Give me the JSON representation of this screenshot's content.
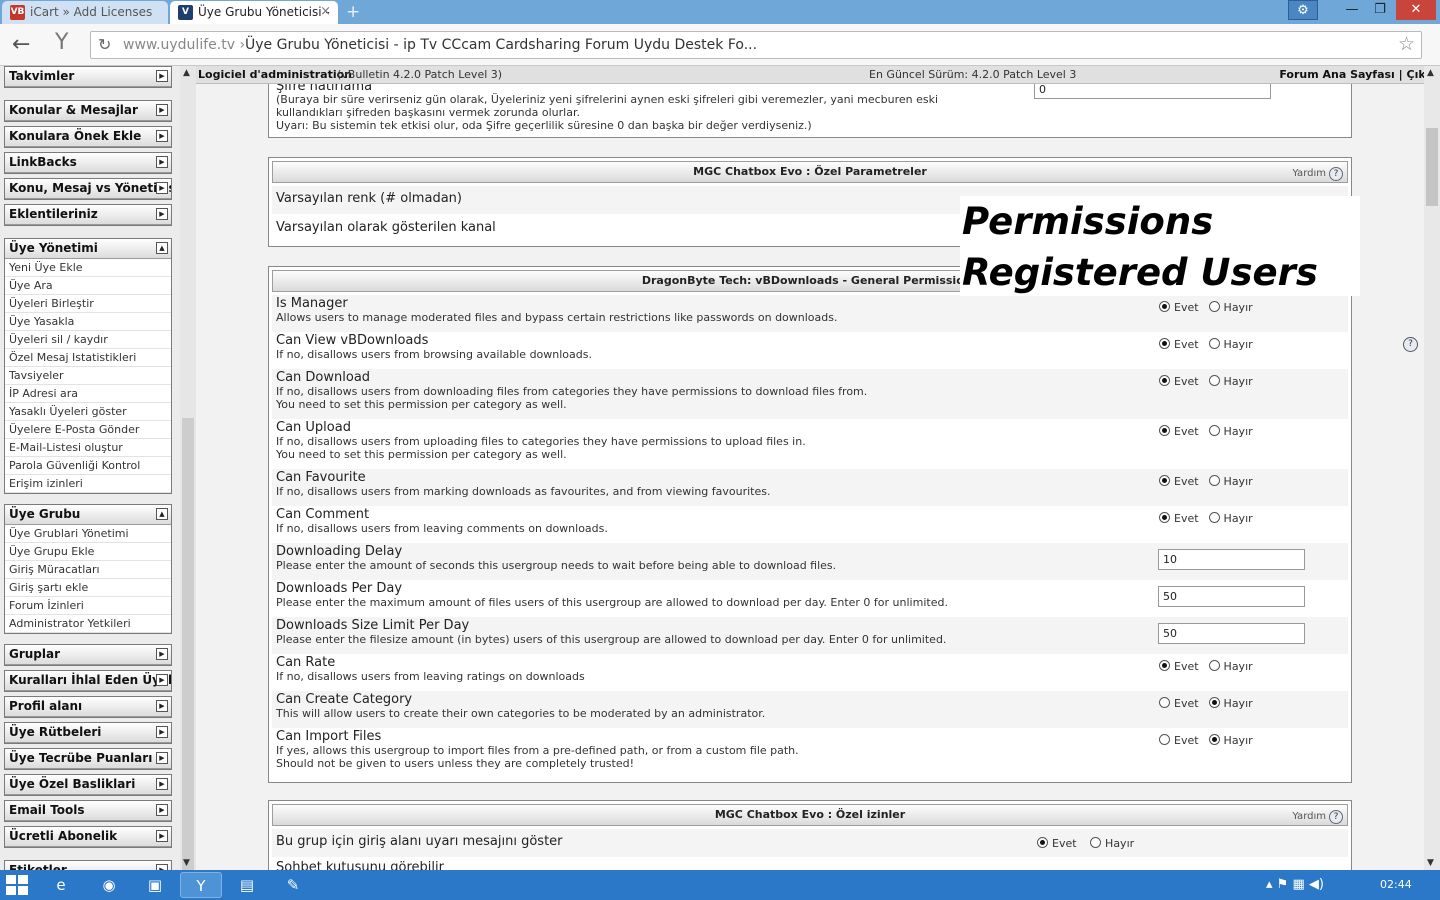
{
  "browser": {
    "tabs": [
      {
        "label": "iCart » Add Licenses",
        "favicon": "VB"
      },
      {
        "label": "Üye Grubu Yöneticisi -",
        "favicon": "V"
      }
    ],
    "new_tab": "+",
    "url_domain": "www.uydulife.tv",
    "url_sep": "›",
    "page_title": "Üye Grubu Yöneticisi - ip Tv CCcam Cardsharing Forum Uydu Destek Fo..."
  },
  "admin_bar": {
    "title": "Logiciel d'administration",
    "version": "(vBulletin 4.2.0 Patch Level 3)",
    "latest": "En Güncel Sürüm: 4.2.0 Patch Level 3",
    "links": "Forum Ana Sayfası | Çıkış"
  },
  "sidebar": {
    "groups": [
      {
        "title": "Takvimler",
        "items": []
      },
      {
        "title": "Konular & Mesajlar",
        "items": []
      },
      {
        "title": "Konulara Önek Ekle",
        "items": []
      },
      {
        "title": "LinkBacks",
        "items": []
      },
      {
        "title": "Konu, Mesaj vs Yöneticisi",
        "items": []
      },
      {
        "title": "Eklentileriniz",
        "items": []
      },
      {
        "title": "Üye Yönetimi",
        "items": [
          "Yeni Üye Ekle",
          "Üye Ara",
          "Üyeleri Birleştir",
          "Üye Yasakla",
          "Üyeleri sil / kaydır",
          "Özel Mesaj Istatistikleri",
          "Tavsiyeler",
          "İP Adresi ara",
          "Yasaklı Üyeleri göster",
          "Üyelere E-Posta Gönder",
          "E-Mail-Listesi oluştur",
          "Parola Güvenliği Kontrol",
          "Erişim izinleri"
        ]
      },
      {
        "title": "Üye Grubu",
        "items": [
          "Üye Grublari Yönetimi",
          "Üye Grupu Ekle",
          "Giriş Müracatları",
          "Giriş şartı ekle",
          "Forum İzinleri",
          "Administrator Yetkileri"
        ]
      },
      {
        "title": "Gruplar",
        "items": []
      },
      {
        "title": "Kuralları İhlal Eden Üyeler",
        "items": []
      },
      {
        "title": "Profil alanı",
        "items": []
      },
      {
        "title": "Üye Rütbeleri",
        "items": []
      },
      {
        "title": "Üye Tecrübe Puanları",
        "items": []
      },
      {
        "title": "Üye Özel Basliklari",
        "items": []
      },
      {
        "title": "Email Tools",
        "items": []
      },
      {
        "title": "Ücretli Abonelik",
        "items": []
      },
      {
        "title": "Etiketler",
        "items": []
      }
    ]
  },
  "top_section": {
    "title": "Şifre hatırlama",
    "desc": [
      "(Buraya bir süre verirseniz gün olarak, Üyeleriniz yeni şifrelerini aynen eski şifreleri gibi veremezler, yani mecburen eski",
      "kullandıkları şifreden başkasını vermek zorunda olurlar.",
      "Uyarı: Bu sistemin tek etkisi olur, oda Şifre geçerlilik süresine 0 dan başka bir değer verdiyseniz.)"
    ],
    "value": "0"
  },
  "chatbox_params": {
    "header": "MGC Chatbox Evo : Özel Parametreler",
    "help": "Yardım",
    "rows": [
      "Varsayılan renk (# olmadan)",
      "Varsayılan olarak gösterilen kanal"
    ]
  },
  "downloads": {
    "header": "DragonByte Tech: vBDownloads - General Permissions",
    "yes": "Evet",
    "no": "Hayır",
    "rows": [
      {
        "title": "Is Manager",
        "desc": [
          "Allows users to manage moderated files and bypass certain restrictions like passwords on downloads."
        ],
        "type": "radio",
        "value": "yes"
      },
      {
        "title": "Can View vBDownloads",
        "desc": [
          "If no, disallows users from browsing available downloads."
        ],
        "type": "radio",
        "value": "yes"
      },
      {
        "title": "Can Download",
        "desc": [
          "If no, disallows users from downloading files from categories they have permissions to download files from.",
          "You need to set this permission per category as well."
        ],
        "type": "radio",
        "value": "yes"
      },
      {
        "title": "Can Upload",
        "desc": [
          "If no, disallows users from uploading files to categories they have permissions to upload files in.",
          "You need to set this permission per category as well."
        ],
        "type": "radio",
        "value": "yes"
      },
      {
        "title": "Can Favourite",
        "desc": [
          "If no, disallows users from marking downloads as favourites, and from viewing favourites."
        ],
        "type": "radio",
        "value": "yes"
      },
      {
        "title": "Can Comment",
        "desc": [
          "If no, disallows users from leaving comments on downloads."
        ],
        "type": "radio",
        "value": "yes"
      },
      {
        "title": "Downloading Delay",
        "desc": [
          "Please enter the amount of seconds this usergroup needs to wait before being able to download files."
        ],
        "type": "text",
        "value": "10"
      },
      {
        "title": "Downloads Per Day",
        "desc": [
          "Please enter the maximum amount of files users of this usergroup are allowed to download per day. Enter 0 for unlimited."
        ],
        "type": "text",
        "value": "50"
      },
      {
        "title": "Downloads Size Limit Per Day",
        "desc": [
          "Please enter the filesize amount (in bytes) users of this usergroup are allowed to download per day. Enter 0 for unlimited."
        ],
        "type": "text",
        "value": "50"
      },
      {
        "title": "Can Rate",
        "desc": [
          "If no, disallows users from leaving ratings on downloads"
        ],
        "type": "radio",
        "value": "yes"
      },
      {
        "title": "Can Create Category",
        "desc": [
          "This will allow users to create their own categories to be moderated by an administrator."
        ],
        "type": "radio",
        "value": "no"
      },
      {
        "title": "Can Import Files",
        "desc": [
          "If yes, allows this usergroup to import files from a pre-defined path, or from a custom file path.",
          "Should not be given to users unless they are completely trusted!"
        ],
        "type": "radio",
        "value": "no"
      }
    ]
  },
  "chatbox_perms": {
    "header": "MGC Chatbox Evo : Özel izinler",
    "help": "Yardım",
    "rows": [
      "Bu grup için giriş alanı uyarı mesajını göster",
      "Sohbet kutusunu görebilir"
    ]
  },
  "overlay": {
    "line1": "Permissions",
    "line2": "Registered Users"
  },
  "taskbar": {
    "clock": "02:44"
  }
}
